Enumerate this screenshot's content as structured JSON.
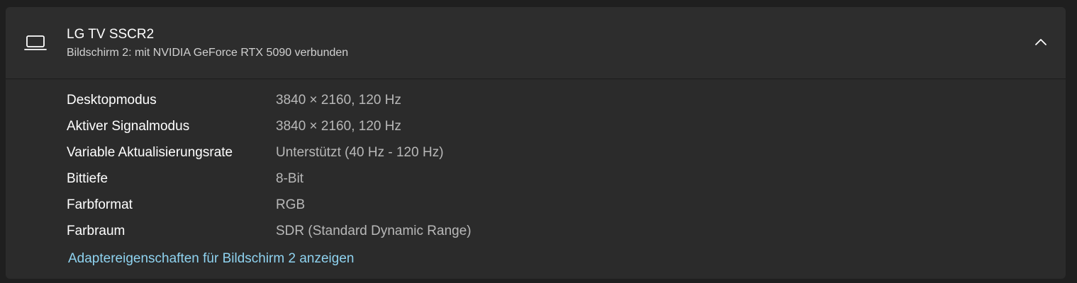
{
  "display": {
    "title": "LG TV SSCR2",
    "subtitle": "Bildschirm 2: mit NVIDIA GeForce RTX 5090 verbunden",
    "icon": "laptop-icon",
    "expanded_icon": "chevron-up-icon"
  },
  "details": [
    {
      "label": "Desktopmodus",
      "value": "3840 × 2160, 120 Hz"
    },
    {
      "label": "Aktiver Signalmodus",
      "value": "3840 × 2160, 120 Hz"
    },
    {
      "label": "Variable Aktualisierungsrate",
      "value": "Unterstützt (40 Hz - 120 Hz)"
    },
    {
      "label": "Bittiefe",
      "value": "8-Bit"
    },
    {
      "label": "Farbformat",
      "value": "RGB"
    },
    {
      "label": "Farbraum",
      "value": "SDR (Standard Dynamic Range)"
    }
  ],
  "link": {
    "label": "Adaptereigenschaften für Bildschirm 2 anzeigen"
  },
  "colors": {
    "background": "#1f1f1f",
    "card": "#2b2b2b",
    "link": "#8fd3f0",
    "value_text": "#b8b8b8"
  }
}
